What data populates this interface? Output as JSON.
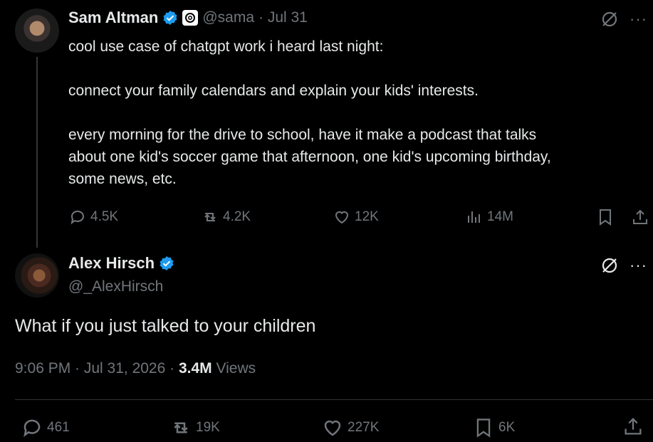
{
  "tweet1": {
    "name": "Sam Altman",
    "handle": "@sama",
    "date": "· Jul 31",
    "text_lines": [
      "cool use case of chatgpt work i heard last night:",
      "",
      "connect your family calendars and explain your kids' interests.",
      "",
      "every morning for the drive to school, have it make a podcast that talks",
      "about one kid's soccer game that afternoon, one kid's upcoming birthday,",
      "some news, etc."
    ],
    "replies": "4.5K",
    "reposts": "4.2K",
    "likes": "12K",
    "views": "14M"
  },
  "tweet2": {
    "name": "Alex Hirsch",
    "handle": "@_AlexHirsch",
    "text": "What if you just talked to your children",
    "time": "9:06 PM · Jul 31, 2026 · ",
    "views_count": "3.4M",
    "views_label": " Views",
    "replies": "461",
    "reposts": "19K",
    "likes": "227K",
    "bookmarks": "6K"
  },
  "colors": {
    "accent": "#1d9bf0",
    "muted": "#71767b",
    "text": "#e7e9ea"
  }
}
